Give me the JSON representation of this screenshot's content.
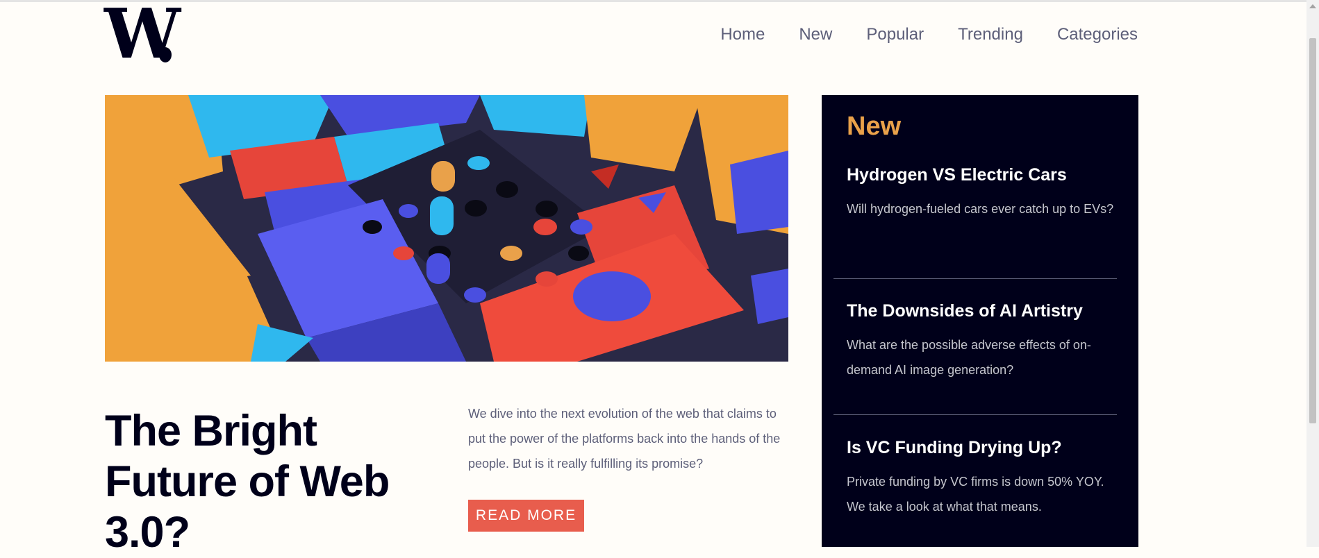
{
  "brand": {
    "logo_text": "W"
  },
  "nav": {
    "items": [
      "Home",
      "New",
      "Popular",
      "Trending",
      "Categories"
    ]
  },
  "hero": {
    "headline": "The Bright Future of Web 3.0?",
    "intro": "We dive into the next evolution of the web that claims to put the power of the platforms back into the hands of the people. But is it really fulfilling its promise?",
    "read_more": "READ MORE"
  },
  "new_panel": {
    "title": "New",
    "items": [
      {
        "title": "Hydrogen VS Electric Cars",
        "desc": "Will hydrogen-fueled cars ever catch up to EVs?"
      },
      {
        "title": "The Downsides of AI Artistry",
        "desc": "What are the possible adverse effects of on-demand AI image generation?"
      },
      {
        "title": "Is VC Funding Drying Up?",
        "desc": "Private funding by VC firms is down 50% YOY. We take a look at what that means."
      }
    ]
  },
  "colors": {
    "background": "#fffdf9",
    "dark_blue": "#00001a",
    "accent_orange": "#e9a14a",
    "accent_red": "#e85d4d",
    "grayish_blue": "#5d5f79"
  }
}
